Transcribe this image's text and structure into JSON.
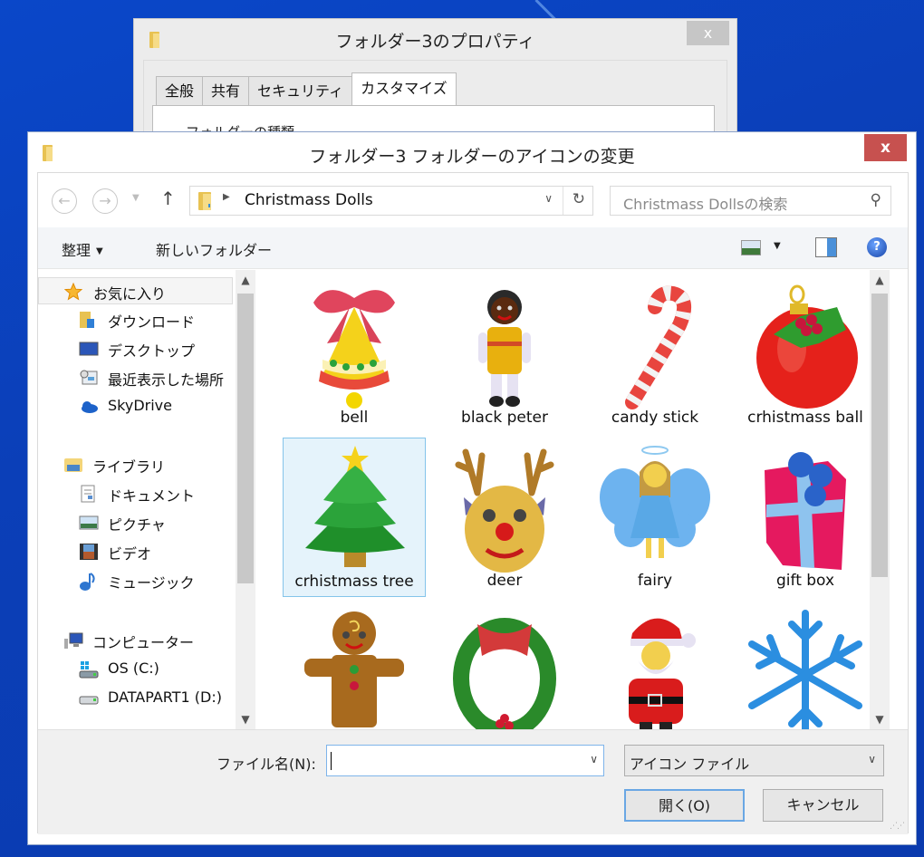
{
  "properties_window": {
    "title": "フォルダー3のプロパティ",
    "close_label": "x",
    "tabs": [
      {
        "label": "全般",
        "active": false
      },
      {
        "label": "共有",
        "active": false
      },
      {
        "label": "セキュリティ",
        "active": false
      },
      {
        "label": "カスタマイズ",
        "active": true
      }
    ],
    "panel_text": "フォルダーの種類"
  },
  "dialog": {
    "title": "フォルダー3 フォルダーのアイコンの変更",
    "close_label": "x",
    "nav": {
      "back_icon": "←",
      "forward_icon": "→",
      "up_icon": "↑",
      "address_crumb": "Christmass Dolls",
      "search_placeholder": "Christmass Dollsの検索"
    },
    "toolbar": {
      "organize_label": "整理",
      "new_folder_label": "新しいフォルダー",
      "help_label": "?"
    },
    "sidebar": {
      "items": [
        {
          "label": "お気に入り",
          "icon": "star-icon",
          "level": 0,
          "selected": true
        },
        {
          "label": "ダウンロード",
          "icon": "downloads-folder-icon",
          "level": 1
        },
        {
          "label": "デスクトップ",
          "icon": "desktop-icon",
          "level": 1
        },
        {
          "label": "最近表示した場所",
          "icon": "recent-places-icon",
          "level": 1
        },
        {
          "label": "SkyDrive",
          "icon": "skydrive-cloud-icon",
          "level": 1
        },
        {
          "label": "ライブラリ",
          "icon": "library-icon",
          "level": 0
        },
        {
          "label": "ドキュメント",
          "icon": "document-icon",
          "level": 1
        },
        {
          "label": "ピクチャ",
          "icon": "pictures-icon",
          "level": 1
        },
        {
          "label": "ビデオ",
          "icon": "video-icon",
          "level": 1
        },
        {
          "label": "ミュージック",
          "icon": "music-icon",
          "level": 1
        },
        {
          "label": "コンピューター",
          "icon": "computer-icon",
          "level": 0
        },
        {
          "label": "OS (C:)",
          "icon": "os-drive-icon",
          "level": 1
        },
        {
          "label": "DATAPART1 (D:)",
          "icon": "drive-icon",
          "level": 1
        }
      ]
    },
    "files": [
      {
        "label": "bell",
        "icon": "bell-icon",
        "selected": false
      },
      {
        "label": "black peter",
        "icon": "doll-icon",
        "selected": false
      },
      {
        "label": "candy stick",
        "icon": "candy-cane-icon",
        "selected": false
      },
      {
        "label": "crhistmass ball",
        "icon": "ornament-ball-icon",
        "selected": false
      },
      {
        "label": "crhistmass tree",
        "icon": "christmas-tree-icon",
        "selected": true
      },
      {
        "label": "deer",
        "icon": "reindeer-icon",
        "selected": false
      },
      {
        "label": "fairy",
        "icon": "fairy-icon",
        "selected": false
      },
      {
        "label": "gift box",
        "icon": "gift-box-icon",
        "selected": false
      },
      {
        "label": "",
        "icon": "gingerbread-man-icon",
        "selected": false
      },
      {
        "label": "",
        "icon": "wreath-icon",
        "selected": false
      },
      {
        "label": "",
        "icon": "santa-icon",
        "selected": false
      },
      {
        "label": "",
        "icon": "snowflake-icon",
        "selected": false
      }
    ],
    "footer": {
      "filename_label": "ファイル名(N):",
      "filename_value": "",
      "filetype_value": "アイコン ファイル",
      "open_label": "開く(O)",
      "cancel_label": "キャンセル"
    }
  }
}
